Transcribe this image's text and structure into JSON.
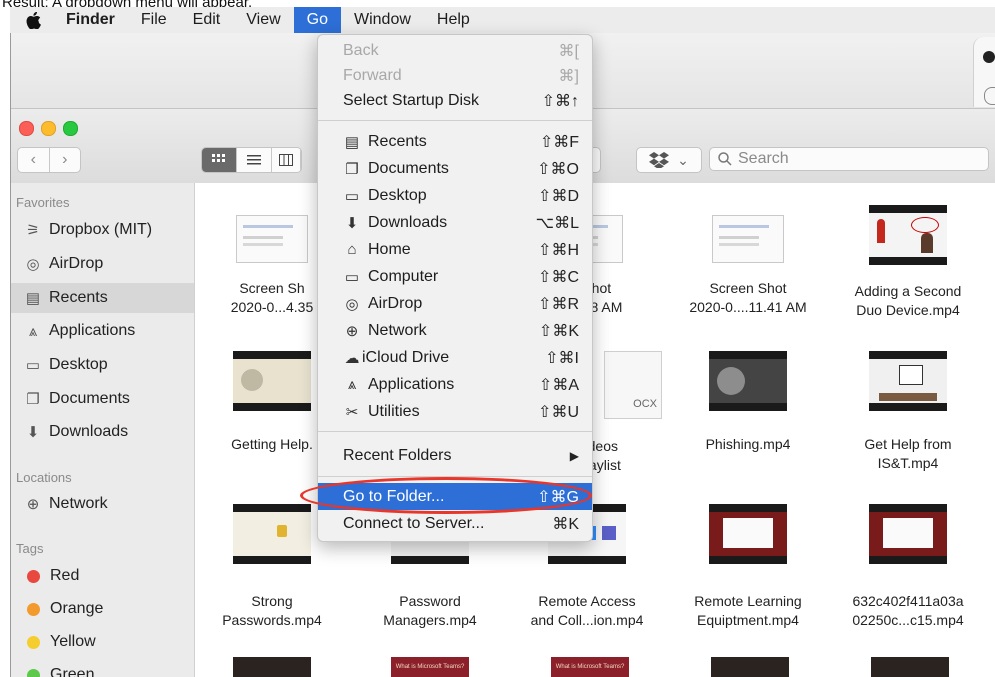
{
  "caption": "Result: A dropdown menu will appear.",
  "menubar": {
    "apple": "",
    "items": [
      "Finder",
      "File",
      "Edit",
      "View",
      "Go",
      "Window",
      "Help"
    ],
    "active": "Go"
  },
  "toolbar": {
    "back": "‹",
    "forward": "›",
    "search_placeholder": "Search",
    "dropbox_chevron": "⌄"
  },
  "sidebar": {
    "favorites_title": "Favorites",
    "favorites": [
      {
        "label": "Dropbox (MIT)",
        "icon": "dropbox-icon"
      },
      {
        "label": "AirDrop",
        "icon": "airdrop-icon"
      },
      {
        "label": "Recents",
        "icon": "recents-icon"
      },
      {
        "label": "Applications",
        "icon": "applications-icon"
      },
      {
        "label": "Desktop",
        "icon": "desktop-icon"
      },
      {
        "label": "Documents",
        "icon": "documents-icon"
      },
      {
        "label": "Downloads",
        "icon": "downloads-icon"
      }
    ],
    "locations_title": "Locations",
    "locations": [
      {
        "label": "Network",
        "icon": "network-icon"
      }
    ],
    "tags_title": "Tags",
    "tags": [
      {
        "label": "Red",
        "color": "#e9483f"
      },
      {
        "label": "Orange",
        "color": "#f29a2e"
      },
      {
        "label": "Yellow",
        "color": "#f5cd2f"
      },
      {
        "label": "Green",
        "color": "#5cc94a"
      }
    ]
  },
  "files": {
    "row1": [
      {
        "l1": "Screen Sh",
        "l2": "2020-0...4.35"
      },
      {
        "l1": "",
        "l2": ""
      },
      {
        "l1": "en Shot",
        "l2": "...12.18 AM"
      },
      {
        "l1": "Screen Shot",
        "l2": "2020-0....11.41 AM"
      },
      {
        "l1": "Adding a Second",
        "l2": "Duo Device.mp4"
      }
    ],
    "row2": [
      {
        "l1": "Getting Help.",
        "l2": ""
      },
      {
        "l1": "",
        "l2": ""
      },
      {
        "l1": "on Videos",
        "l2": "...9 Playlist"
      },
      {
        "l1": "Phishing.mp4",
        "l2": ""
      },
      {
        "l1": "Get Help from",
        "l2": "IS&T.mp4"
      }
    ],
    "row3": [
      {
        "l1": "Strong",
        "l2": "Passwords.mp4"
      },
      {
        "l1": "Password",
        "l2": "Managers.mp4"
      },
      {
        "l1": "Remote Access",
        "l2": "and Coll...ion.mp4"
      },
      {
        "l1": "Remote Learning",
        "l2": "Equiptment.mp4"
      },
      {
        "l1": "632c402f411a03a",
        "l2": "02250c...c15.mp4"
      }
    ],
    "docx_label": "OCX",
    "row4_thumb_text": "What is Microsoft Teams?"
  },
  "go_menu": {
    "back": {
      "label": "Back",
      "shortcut": "⌘["
    },
    "forward": {
      "label": "Forward",
      "shortcut": "⌘]"
    },
    "startup": {
      "label": "Select Startup Disk",
      "shortcut": "⇧⌘↑"
    },
    "places": [
      {
        "label": "Recents",
        "shortcut": "⇧⌘F",
        "icon": "recents-icon"
      },
      {
        "label": "Documents",
        "shortcut": "⇧⌘O",
        "icon": "documents-icon"
      },
      {
        "label": "Desktop",
        "shortcut": "⇧⌘D",
        "icon": "desktop-icon"
      },
      {
        "label": "Downloads",
        "shortcut": "⌥⌘L",
        "icon": "downloads-icon"
      },
      {
        "label": "Home",
        "shortcut": "⇧⌘H",
        "icon": "home-icon"
      },
      {
        "label": "Computer",
        "shortcut": "⇧⌘C",
        "icon": "computer-icon"
      },
      {
        "label": "AirDrop",
        "shortcut": "⇧⌘R",
        "icon": "airdrop-icon"
      },
      {
        "label": "Network",
        "shortcut": "⇧⌘K",
        "icon": "network-icon"
      },
      {
        "label": "iCloud Drive",
        "shortcut": "⇧⌘I",
        "icon": "icloud-icon"
      },
      {
        "label": "Applications",
        "shortcut": "⇧⌘A",
        "icon": "applications-icon"
      },
      {
        "label": "Utilities",
        "shortcut": "⇧⌘U",
        "icon": "utilities-icon"
      }
    ],
    "recent_folders": {
      "label": "Recent Folders",
      "arrow": "▶"
    },
    "go_to_folder": {
      "label": "Go to Folder...",
      "shortcut": "⇧⌘G"
    },
    "connect": {
      "label": "Connect to Server...",
      "shortcut": "⌘K"
    }
  },
  "colors": {
    "accent": "#2d6fd6",
    "highlight_ring": "#e8362a"
  }
}
